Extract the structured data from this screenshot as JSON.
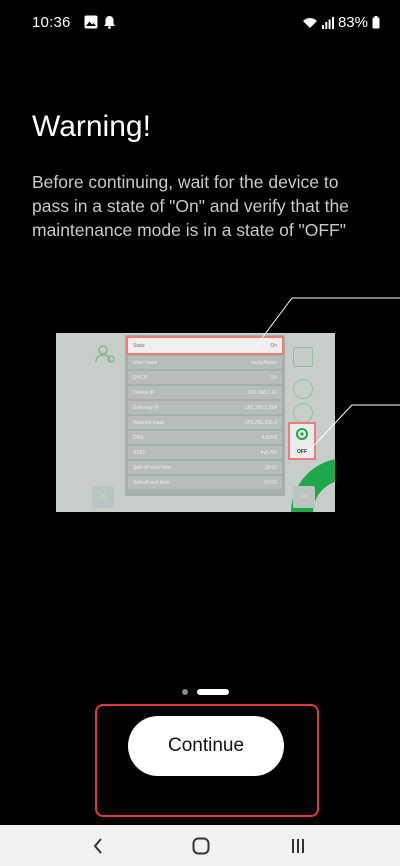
{
  "status_bar": {
    "time": "10:36",
    "battery_text": "83%",
    "icons": [
      "gallery-icon",
      "notification-icon",
      "wifi-icon",
      "signal-icon",
      "battery-icon"
    ]
  },
  "content": {
    "title": "Warning!",
    "body": "Before continuing, wait for the device to pass in a state of \"On\" and verify that the maintenance mode is in a state of \"OFF\""
  },
  "illustration": {
    "status_row": {
      "label": "State",
      "value": "On"
    },
    "rows": [
      {
        "label": "User name",
        "value": "mySpName"
      },
      {
        "label": "DHCP",
        "value": "On"
      },
      {
        "label": "Device IP",
        "value": "192.168.1.10"
      },
      {
        "label": "Gateway IP",
        "value": "192.168.1.254"
      },
      {
        "label": "Network mask",
        "value": "255.255.255.0"
      },
      {
        "label": "DNS",
        "value": "8.8.8.8"
      },
      {
        "label": "SSID",
        "value": "myLAN"
      },
      {
        "label": "Self-off start time",
        "value": "18:00"
      },
      {
        "label": "Self-off end time",
        "value": "07:00"
      }
    ],
    "maintenance_label": "OFF",
    "ok_label": "OK"
  },
  "pager": {
    "pages": 2,
    "active_index": 1
  },
  "actions": {
    "continue_label": "Continue"
  },
  "nav": {
    "back_icon": "back-chevron-icon",
    "home_icon": "home-icon",
    "recents_icon": "recents-icon"
  },
  "colors": {
    "highlight": "#e03a3a",
    "accent_green": "#1ea84a"
  }
}
